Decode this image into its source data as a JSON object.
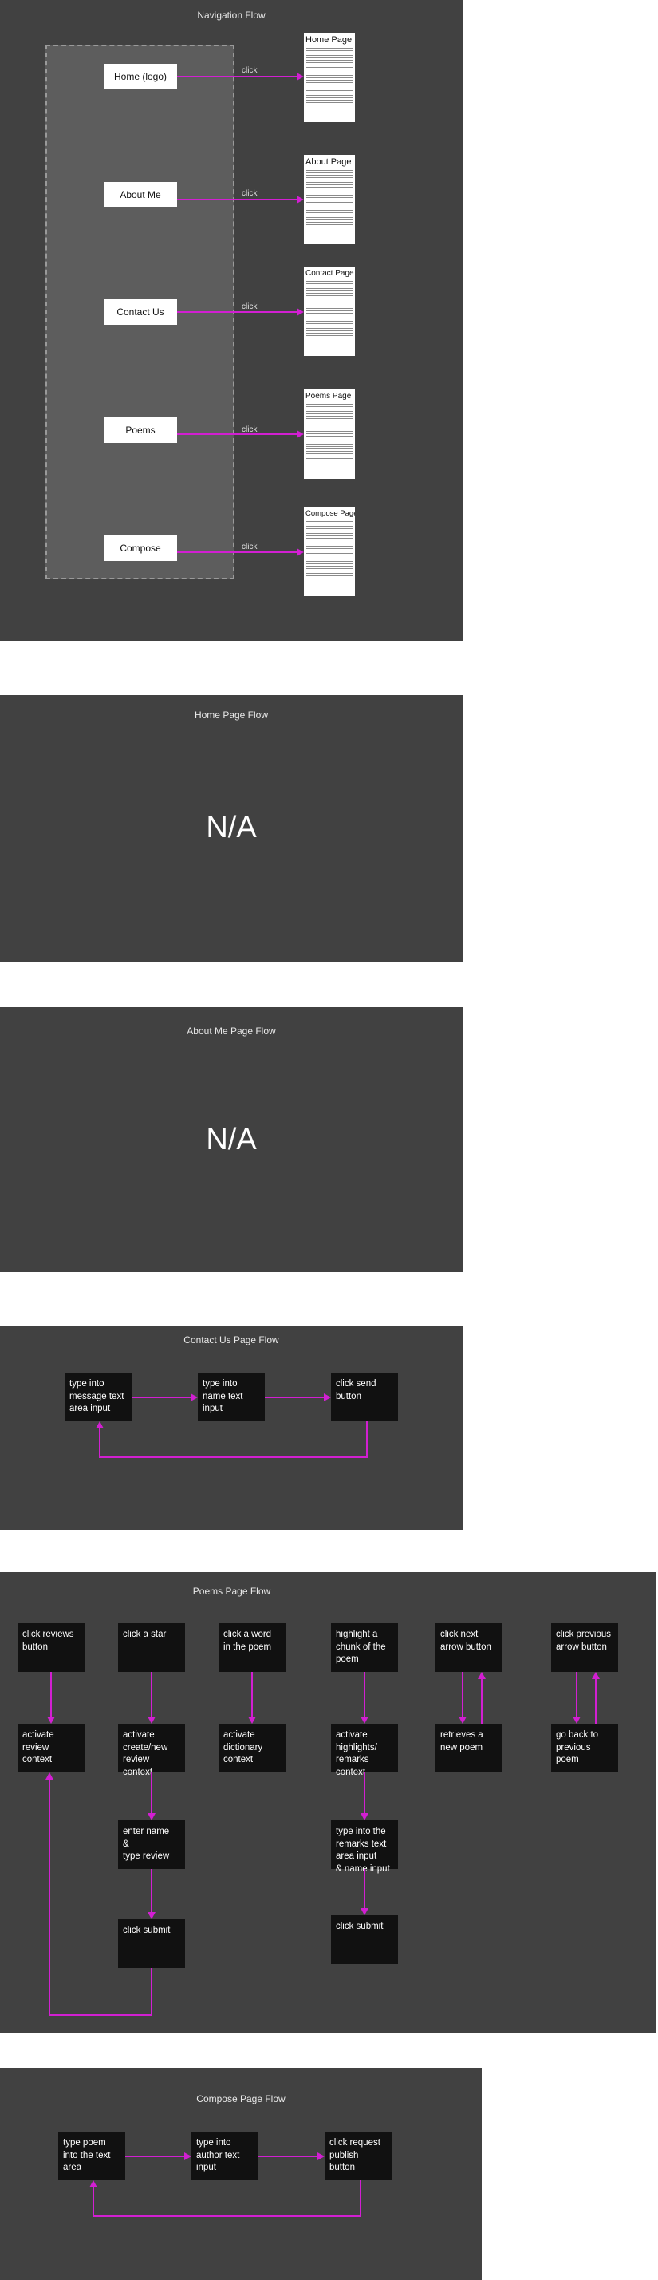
{
  "colors": {
    "frame": "#414141",
    "box": "#111111",
    "arrow": "#d21fd2"
  },
  "nav": {
    "title": "Navigation Flow",
    "buttons": [
      "Home (logo)",
      "About Me",
      "Contact Us",
      "Poems",
      "Compose"
    ],
    "click_label": "click",
    "pages": [
      "Home Page",
      "About Page",
      "Contact Page",
      "Poems Page",
      "Compose Page"
    ]
  },
  "home": {
    "title": "Home Page Flow",
    "na": "N/A"
  },
  "about": {
    "title": "About Me Page Flow",
    "na": "N/A"
  },
  "contact": {
    "title": "Contact Us Page Flow",
    "steps": [
      "type into\nmessage text\narea input",
      "type into\nname text\ninput",
      "click send\nbutton"
    ]
  },
  "poems": {
    "title": "Poems Page Flow",
    "triggers": [
      "click reviews\nbutton",
      "click a star",
      "click a word\nin the poem",
      "highlight a\nchunk of the\npoem",
      "click next\narrow button",
      "click previous\narrow button"
    ],
    "results": [
      "activate\nreview\ncontext",
      "activate\ncreate/new\nreview\ncontext",
      "activate\ndictionary\ncontext",
      "activate\nhighlights/\nremarks\ncontext",
      "retrieves a\nnew poem",
      "go back to\nprevious\npoem"
    ],
    "review_steps": [
      "enter name\n&\ntype review",
      "click submit"
    ],
    "remark_steps": [
      "type into the\nremarks text\narea input\n& name input",
      "click submit"
    ]
  },
  "compose": {
    "title": "Compose Page Flow",
    "steps": [
      "type poem\ninto the text\narea",
      "type into\nauthor text\ninput",
      "click request\npublish\nbutton"
    ]
  }
}
